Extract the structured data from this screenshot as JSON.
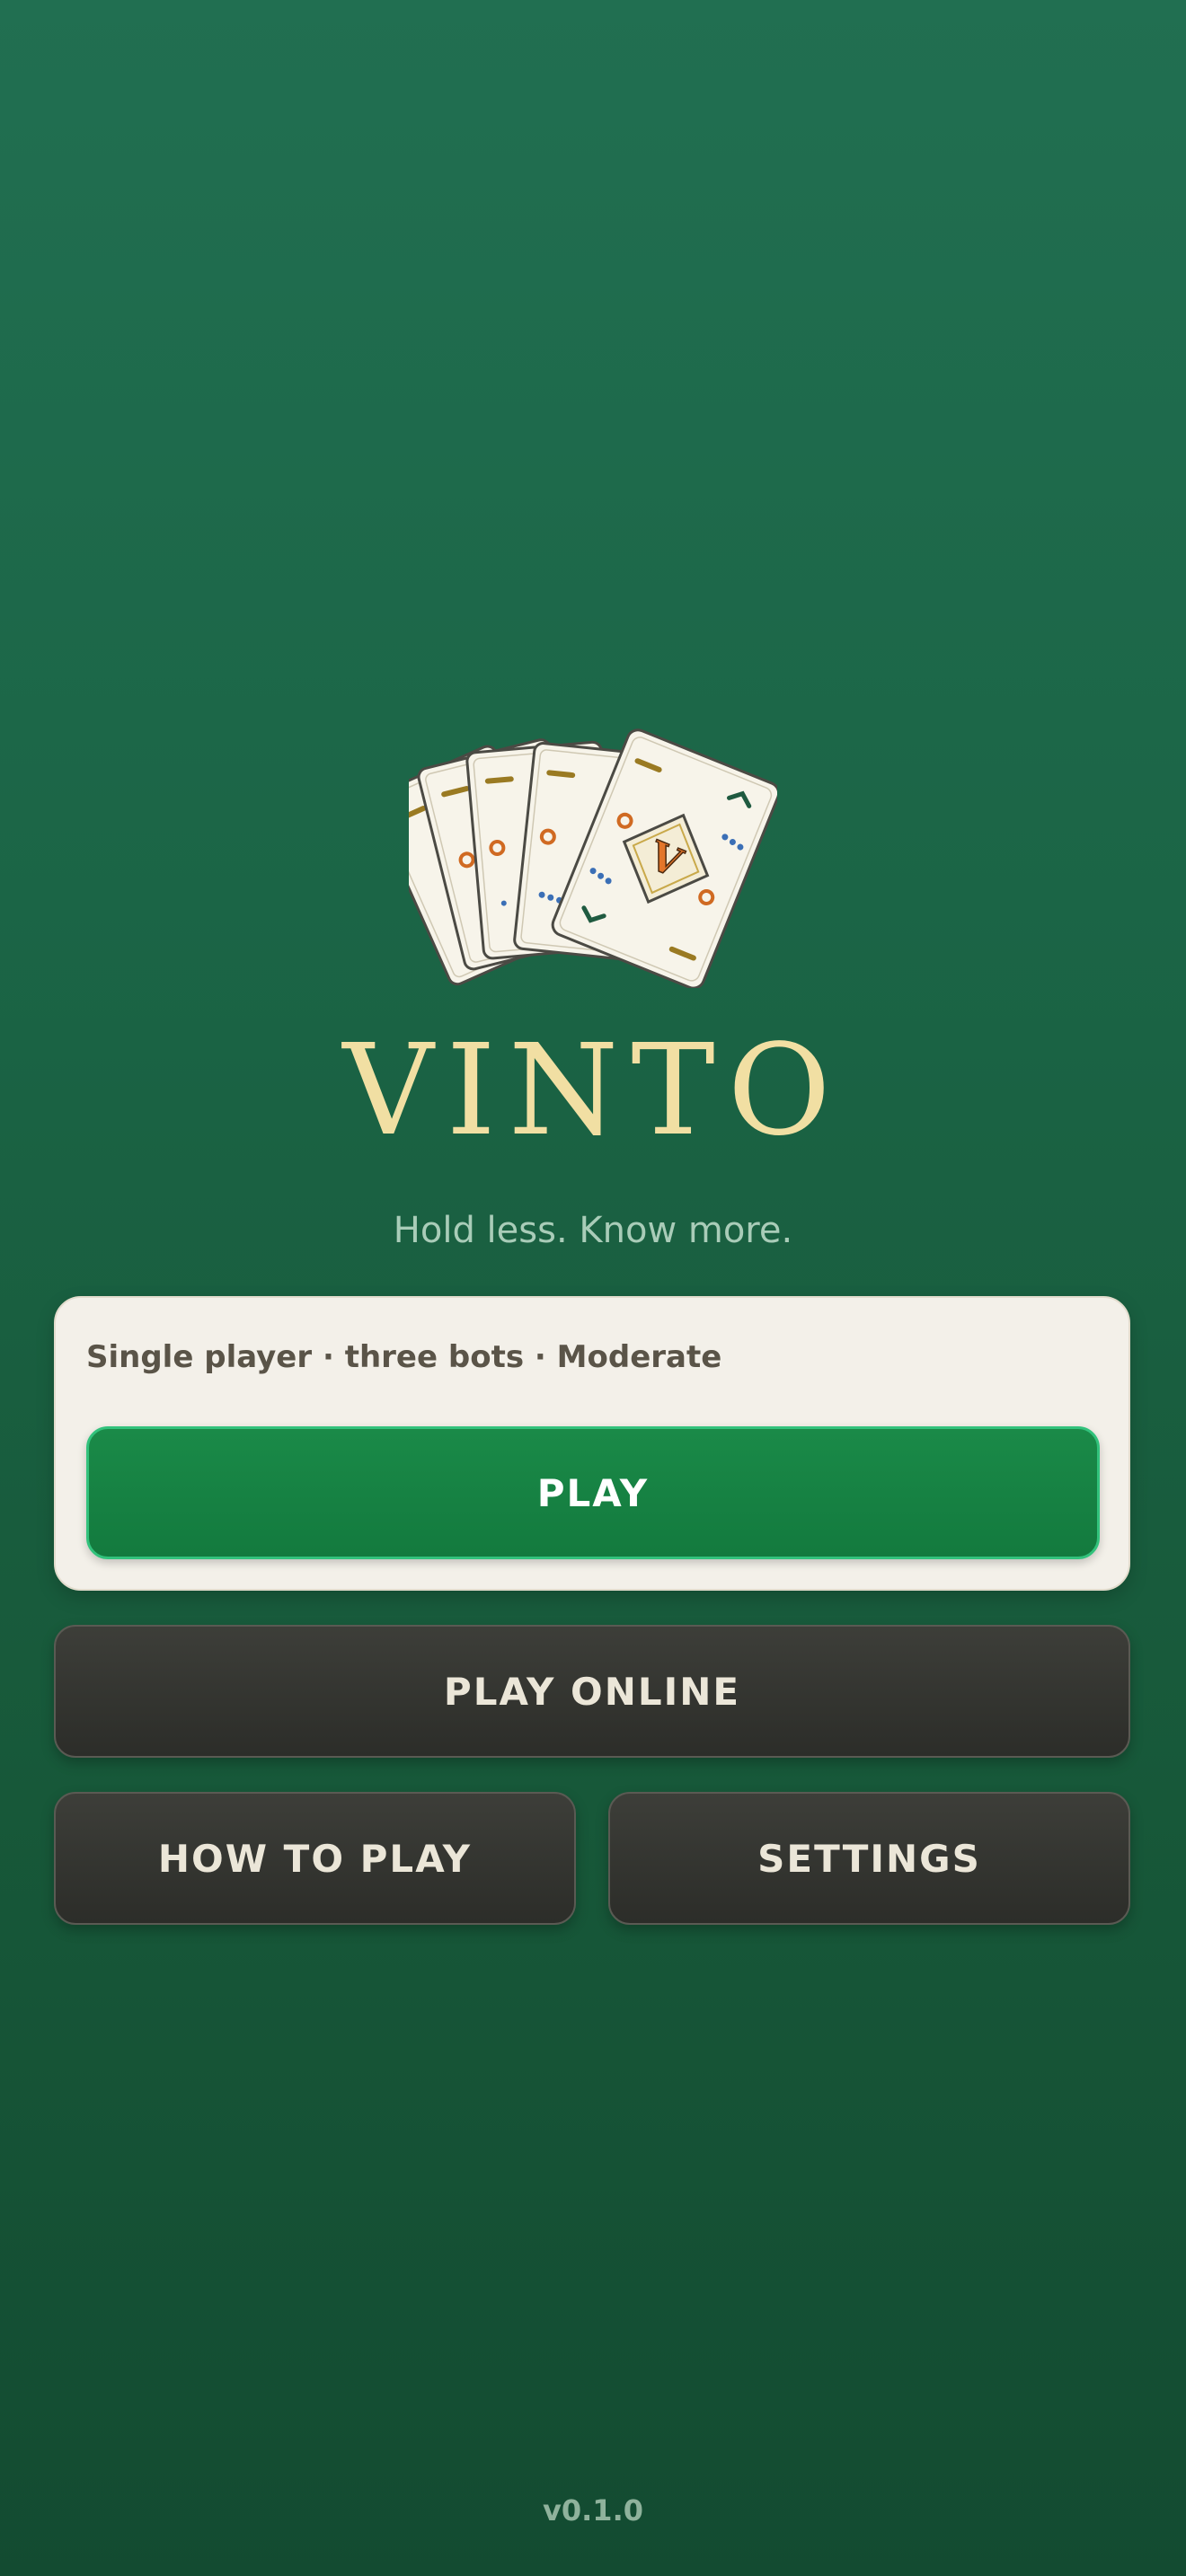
{
  "app": {
    "title": "VINTO",
    "tagline": "Hold less. Know more.",
    "version": "v0.1.0"
  },
  "logo": {
    "icon": "fanned-cards-icon",
    "center_card_letter": "V"
  },
  "quick_play": {
    "mode_text": "Single player · three bots · Moderate",
    "play_label": "PLAY"
  },
  "menu": {
    "play_online_label": "PLAY ONLINE",
    "how_to_play_label": "HOW TO PLAY",
    "settings_label": "SETTINGS"
  },
  "colors": {
    "background": "#1b6546",
    "title_gold": "#f1dfa3",
    "play_green": "#1a8a48",
    "dark_button": "#353631",
    "card_face": "#f7f4ea"
  }
}
